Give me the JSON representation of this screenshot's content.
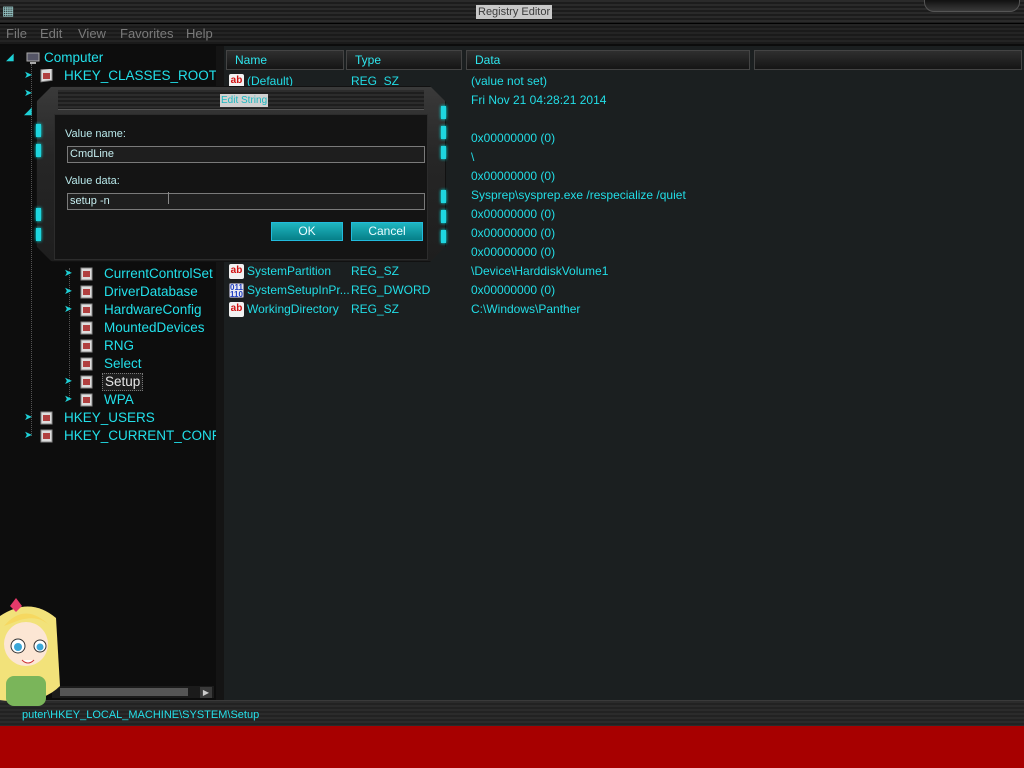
{
  "window": {
    "title": "Registry Editor"
  },
  "menu": [
    "File",
    "Edit",
    "View",
    "Favorites",
    "Help"
  ],
  "tree": {
    "root": "Computer",
    "hives_top": [
      "HKEY_CLASSES_ROOT"
    ],
    "system_subkeys": [
      {
        "label": "CurrentControlSet",
        "expandable": true
      },
      {
        "label": "DriverDatabase",
        "expandable": true
      },
      {
        "label": "HardwareConfig",
        "expandable": true
      },
      {
        "label": "MountedDevices",
        "expandable": false
      },
      {
        "label": "RNG",
        "expandable": false
      },
      {
        "label": "Select",
        "expandable": false
      },
      {
        "label": "Setup",
        "expandable": true,
        "selected": true
      },
      {
        "label": "WPA",
        "expandable": true
      }
    ],
    "hives_bottom": [
      "HKEY_USERS",
      "HKEY_CURRENT_CONFI"
    ]
  },
  "list": {
    "columns": [
      "Name",
      "Type",
      "Data"
    ],
    "rows": [
      {
        "name": "(Default)",
        "type": "REG_SZ",
        "data": "(value not set)",
        "icon": "string-value-icon"
      },
      {
        "name": "",
        "type": "",
        "data": "Fri Nov 21 04:28:21 2014",
        "icon": ""
      },
      {
        "name": "",
        "type": "",
        "data": "",
        "icon": ""
      },
      {
        "name": "",
        "type": "",
        "data": "0x00000000 (0)",
        "icon": ""
      },
      {
        "name": "",
        "type": "",
        "data": "\\",
        "icon": ""
      },
      {
        "name": "",
        "type": "",
        "data": "0x00000000 (0)",
        "icon": ""
      },
      {
        "name": "",
        "type": "",
        "data": "Sysprep\\sysprep.exe /respecialize /quiet",
        "icon": ""
      },
      {
        "name": "",
        "type": "",
        "data": "0x00000000 (0)",
        "icon": ""
      },
      {
        "name": "",
        "type": "",
        "data": "0x00000000 (0)",
        "icon": ""
      },
      {
        "name": "",
        "type": "",
        "data": "0x00000000 (0)",
        "icon": ""
      },
      {
        "name": "SystemPartition",
        "type": "REG_SZ",
        "data": "\\Device\\HarddiskVolume1",
        "icon": "string-value-icon"
      },
      {
        "name": "SystemSetupInPr...",
        "type": "REG_DWORD",
        "data": "0x00000000 (0)",
        "icon": "binary-value-icon"
      },
      {
        "name": "WorkingDirectory",
        "type": "REG_SZ",
        "data": "C:\\Windows\\Panther",
        "icon": "string-value-icon"
      }
    ]
  },
  "status": {
    "path": "puter\\HKEY_LOCAL_MACHINE\\SYSTEM\\Setup"
  },
  "dialog": {
    "title": "Edit String",
    "value_name_label": "Value name:",
    "value_name": "CmdLine",
    "value_data_label": "Value data:",
    "value_data": "setup -n",
    "ok_label": "OK",
    "cancel_label": "Cancel"
  },
  "colors": {
    "accent": "#22e0ea",
    "taskbar": "#a70000",
    "background": "#0c0c0c"
  }
}
